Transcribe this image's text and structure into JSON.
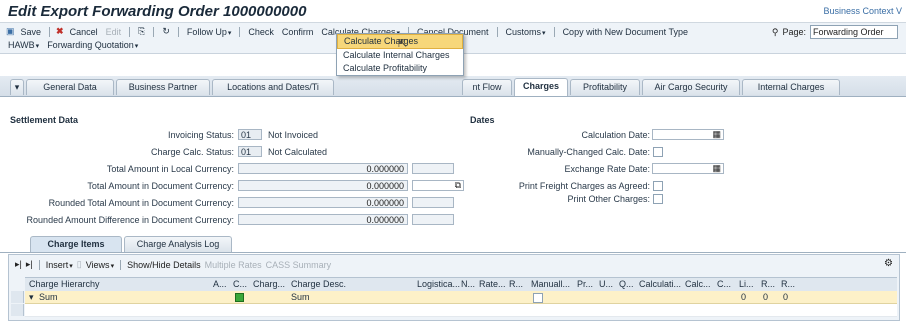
{
  "header": {
    "title": "Edit Export Forwarding Order 1000000000",
    "business_context": "Business Context V"
  },
  "toolbar": {
    "save": "Save",
    "cancel": "Cancel",
    "edit": "Edit",
    "follow_up": "Follow Up",
    "check": "Check",
    "confirm": "Confirm",
    "calculate_charges": "Calculate Charges",
    "cancel_document": "Cancel Document",
    "customs": "Customs",
    "copy_new_doc_type": "Copy with New Document Type",
    "page_label": "Page:",
    "page_value": "Forwarding Order",
    "hawb": "HAWB",
    "forwarding_quotation": "Forwarding Quotation"
  },
  "dropdown": {
    "items": [
      "Calculate Charges",
      "Calculate Internal Charges",
      "Calculate Profitability"
    ]
  },
  "tabs": {
    "items": [
      "General Data",
      "Business Partner",
      "Locations and Dates/Ti",
      "nt Flow",
      "Charges",
      "Profitability",
      "Air Cargo Security",
      "Internal Charges"
    ],
    "active": "Charges"
  },
  "settlement": {
    "title": "Settlement Data",
    "invoicing_status_label": "Invoicing Status:",
    "invoicing_status_code": "01",
    "invoicing_status_text": "Not Invoiced",
    "charge_calc_status_label": "Charge Calc. Status:",
    "charge_calc_status_code": "01",
    "charge_calc_status_text": "Not Calculated",
    "total_local_label": "Total Amount in Local Currency:",
    "total_local_value": "0.000000",
    "total_doc_label": "Total Amount in Document Currency:",
    "total_doc_value": "0.000000",
    "rounded_total_label": "Rounded Total Amount in Document Currency:",
    "rounded_total_value": "0.000000",
    "rounded_diff_label": "Rounded Amount Difference in Document Currency:",
    "rounded_diff_value": "0.000000"
  },
  "dates": {
    "title": "Dates",
    "calc_date_label": "Calculation Date:",
    "manual_calc_label": "Manually-Changed Calc. Date:",
    "exchange_rate_label": "Exchange Rate Date:",
    "print_freight_label": "Print Freight Charges as Agreed:",
    "print_other_label": "Print Other Charges:"
  },
  "subtabs": {
    "items": [
      "Charge Items",
      "Charge Analysis Log"
    ],
    "active": "Charge Items"
  },
  "charge_items": {
    "toolbar": {
      "insert": "Insert",
      "views": "Views",
      "show_hide": "Show/Hide Details",
      "multiple_rates": "Multiple Rates",
      "cass_summary": "CASS Summary"
    },
    "columns": [
      "Charge Hierarchy",
      "A...",
      "C...",
      "Charg...",
      "Charge Desc.",
      "Logistica...",
      "N...",
      "Rate...",
      "R...",
      "Manuall...",
      "Pr...",
      "U...",
      "Q...",
      "Calculati...",
      "Calc...",
      "C...",
      "Li...",
      "R...",
      "R..."
    ],
    "rows": [
      {
        "hierarchy": "Sum",
        "desc": "Sum",
        "li": "0",
        "r1": "0",
        "r2": "0"
      }
    ]
  }
}
